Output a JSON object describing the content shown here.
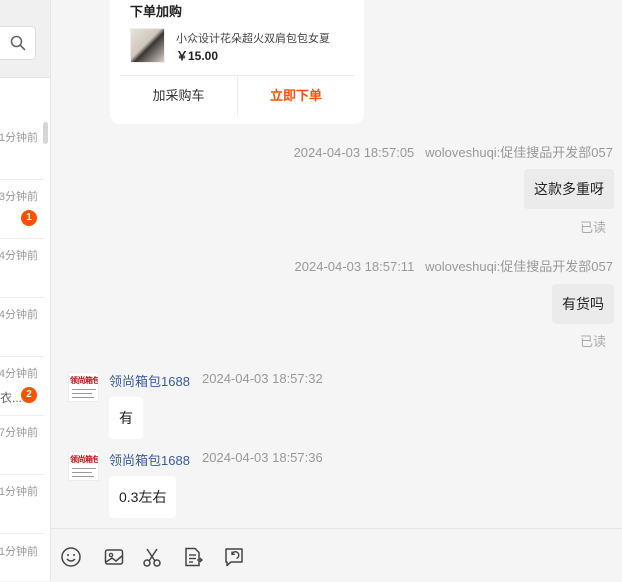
{
  "sidebar": {
    "items": [
      {
        "time": "1分钟前",
        "snippet": "",
        "badge": ""
      },
      {
        "time": "3分钟前",
        "snippet": "",
        "badge": "1"
      },
      {
        "time": "4分钟前",
        "snippet": "",
        "badge": ""
      },
      {
        "time": "4分钟前",
        "snippet": "",
        "badge": ""
      },
      {
        "time": "4分钟前",
        "snippet": "衣...",
        "badge": "2"
      },
      {
        "time": "7分钟前",
        "snippet": "",
        "badge": ""
      },
      {
        "time": "1分钟前",
        "snippet": "",
        "badge": ""
      },
      {
        "time": "1分钟前",
        "snippet": "",
        "badge": ""
      }
    ]
  },
  "product_card": {
    "title": "下单加购",
    "product_name": "小众设计花朵超火双肩包包女夏",
    "price": "￥15.00",
    "add_cart_label": "加采购车",
    "buy_now_label": "立即下单"
  },
  "messages": [
    {
      "sender": "woloveshuqi:促佳搜品开发部057",
      "time": "2024-04-03 18:57:05",
      "text": "这款多重呀",
      "status": "已读"
    },
    {
      "sender": "woloveshuqi:促佳搜品开发部057",
      "time": "2024-04-03 18:57:11",
      "text": "有货吗",
      "status": "已读"
    },
    {
      "sender": "领尚箱包1688",
      "time": "2024-04-03 18:57:32",
      "text": "有",
      "avatar_text": "领尚箱包"
    },
    {
      "sender": "领尚箱包1688",
      "time": "2024-04-03 18:57:36",
      "text": "0.3左右",
      "avatar_text": "领尚箱包"
    }
  ],
  "toolbar": {
    "icons": [
      "emoji-icon",
      "image-icon",
      "scissors-icon",
      "document-icon",
      "recall-icon"
    ]
  },
  "colors": {
    "accent": "#ff5000",
    "sender_name": "#3a5aa0",
    "bubble_self": "#ebebeb",
    "bubble_other": "#ffffff"
  }
}
